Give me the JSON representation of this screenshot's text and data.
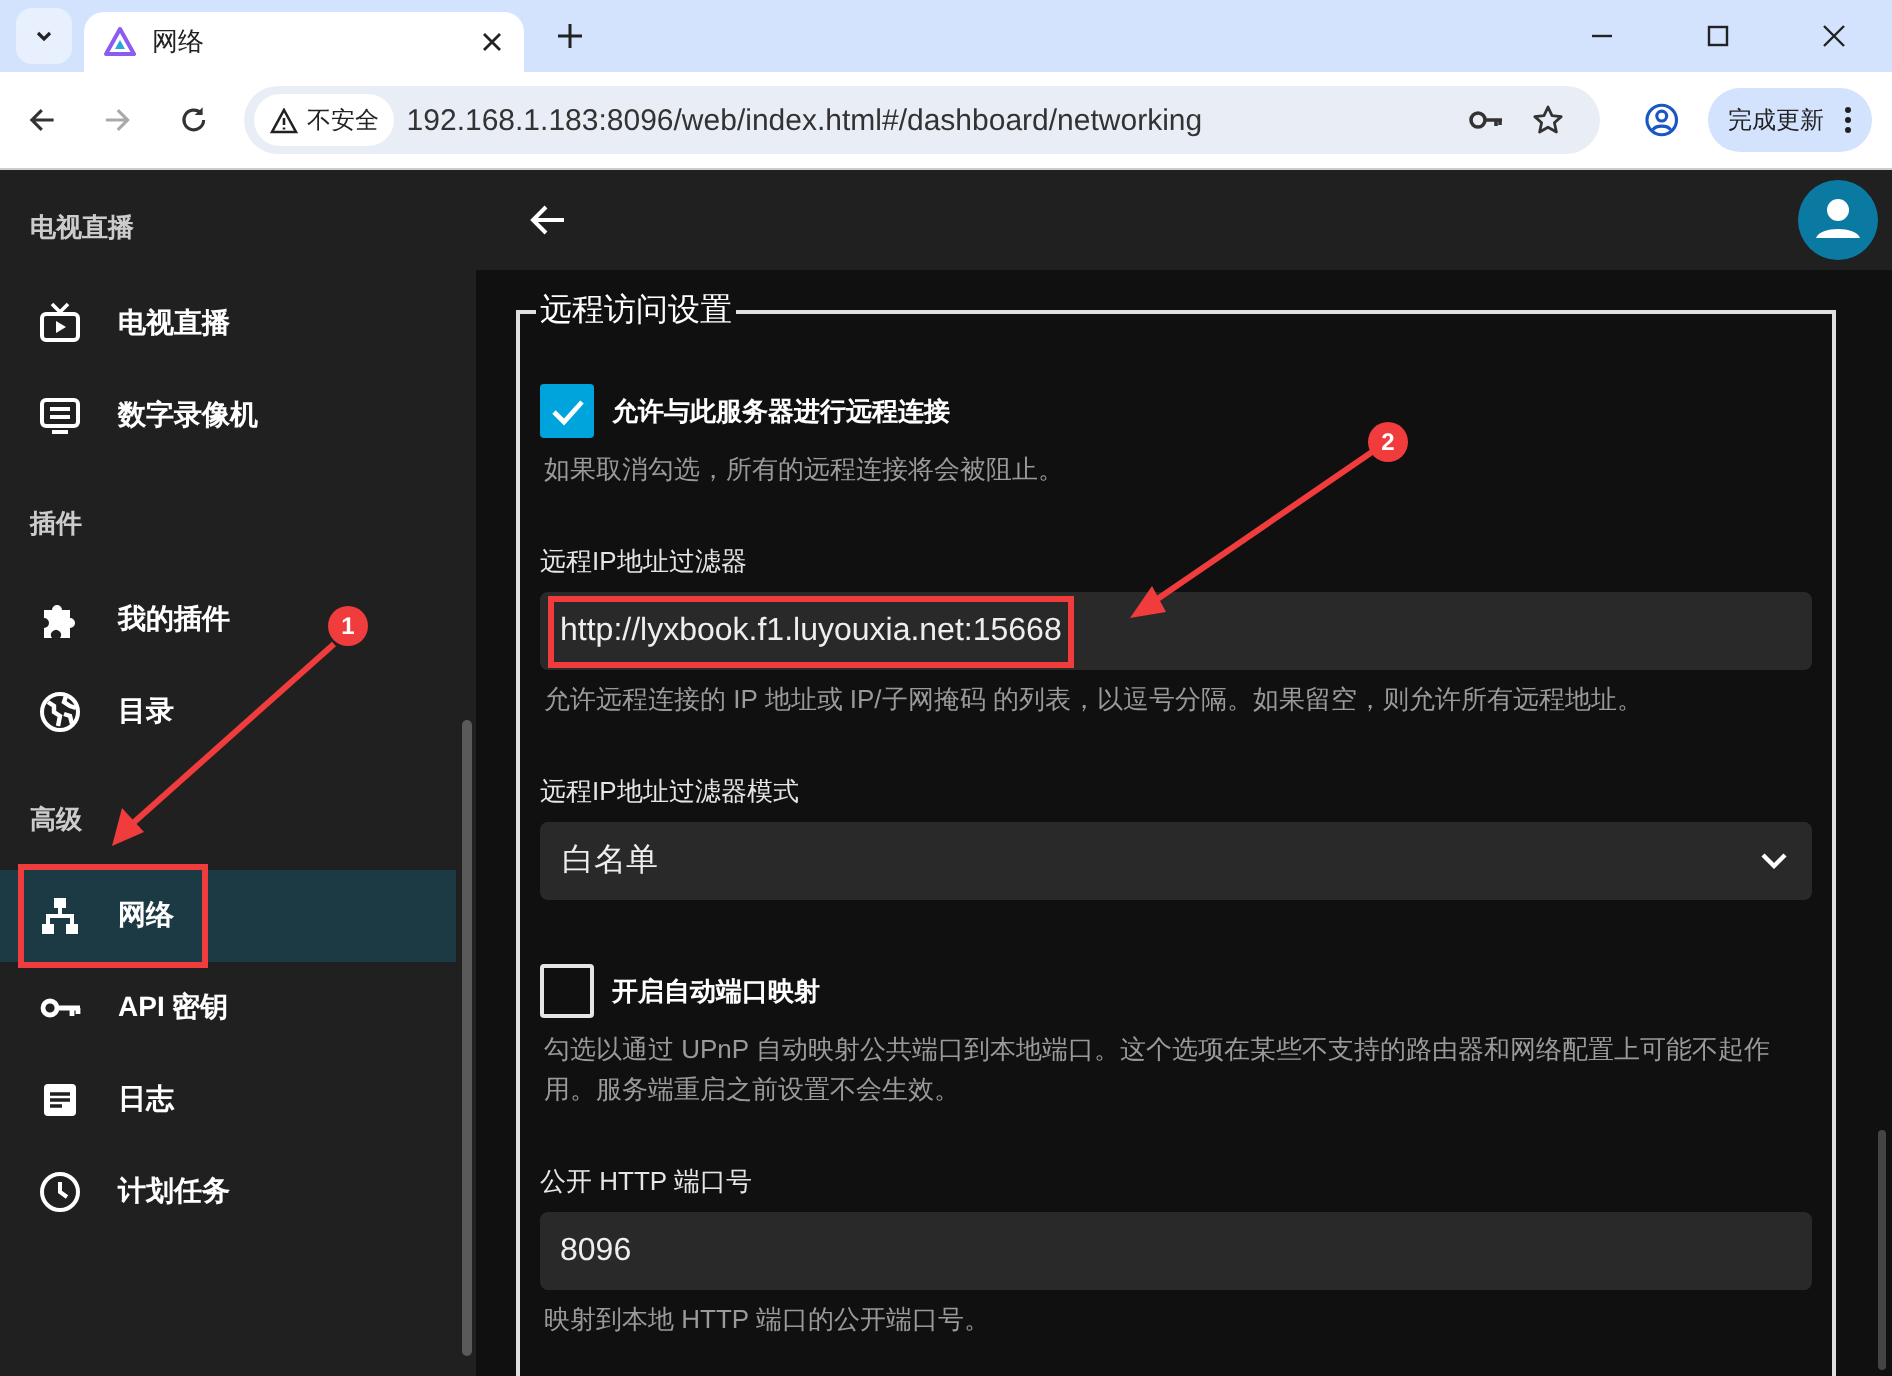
{
  "browser": {
    "tab": {
      "title": "网络"
    },
    "address": {
      "security": "不安全",
      "url": "192.168.1.183:8096/web/index.html#/dashboard/networking"
    },
    "update_button": "完成更新"
  },
  "sidebar": {
    "sections": [
      {
        "heading": "电视直播",
        "items": [
          {
            "label": "电视直播",
            "selected": false,
            "highlighted": false
          },
          {
            "label": "数字录像机",
            "selected": false,
            "highlighted": false
          }
        ]
      },
      {
        "heading": "插件",
        "items": [
          {
            "label": "我的插件",
            "selected": false,
            "highlighted": false
          },
          {
            "label": "目录",
            "selected": false,
            "highlighted": false
          }
        ]
      },
      {
        "heading": "高级",
        "items": [
          {
            "label": "网络",
            "selected": true,
            "highlighted": true
          },
          {
            "label": "API 密钥",
            "selected": false,
            "highlighted": false
          },
          {
            "label": "日志",
            "selected": false,
            "highlighted": false
          },
          {
            "label": "计划任务",
            "selected": false,
            "highlighted": false
          }
        ]
      }
    ]
  },
  "form": {
    "legend": "远程访问设置",
    "fields": [
      {
        "kind": "checkbox",
        "label": "允许与此服务器进行远程连接",
        "checked": true,
        "help": "如果取消勾选，所有的远程连接将会被阻止。"
      },
      {
        "kind": "text",
        "label": "远程IP地址过滤器",
        "value": "http://lyxbook.f1.luyouxia.net:15668",
        "highlighted": true,
        "help": "允许远程连接的 IP 地址或 IP/子网掩码 的列表，以逗号分隔。如果留空，则允许所有远程地址。"
      },
      {
        "kind": "select",
        "label": "远程IP地址过滤器模式",
        "value": "白名单"
      },
      {
        "kind": "checkbox",
        "label": "开启自动端口映射",
        "checked": false,
        "help": "勾选以通过 UPnP 自动映射公共端口到本地端口。这个选项在某些不支持的路由器和网络配置上可能不起作用。服务端重启之前设置不会生效。"
      },
      {
        "kind": "text",
        "label": "公开 HTTP 端口号",
        "value": "8096",
        "highlighted": false,
        "help": "映射到本地 HTTP 端口的公开端口号。"
      }
    ]
  },
  "annotations": [
    {
      "label": "1"
    },
    {
      "label": "2"
    }
  ]
}
